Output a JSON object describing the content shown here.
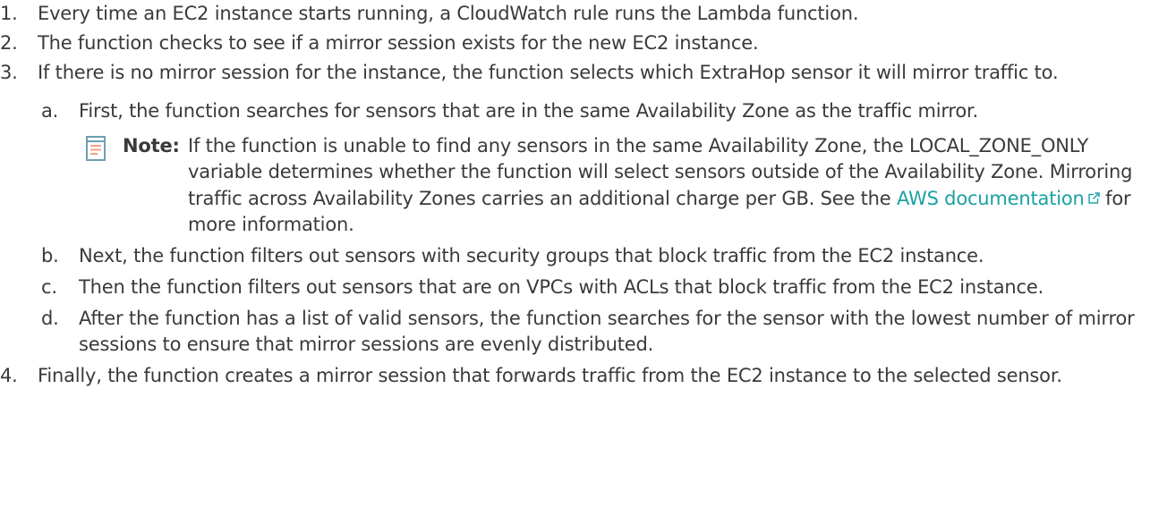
{
  "colors": {
    "text": "#3a3a3a",
    "link": "#1aa1a3",
    "note_icon": "#6f9fb1",
    "note_lines": "#f0a187"
  },
  "steps": [
    {
      "num": "1.",
      "text": "Every time an EC2 instance starts running, a CloudWatch rule runs the Lambda function."
    },
    {
      "num": "2.",
      "text": "The function checks to see if a mirror session exists for the new EC2 instance."
    },
    {
      "num": "3.",
      "text": "If there is no mirror session for the instance, the function selects which ExtraHop sensor it will mirror traffic to."
    },
    {
      "num": "4.",
      "text": "Finally, the function creates a mirror session that forwards traffic from the EC2 instance to the selected sensor."
    }
  ],
  "substeps": [
    {
      "letter": "a.",
      "text": "First, the function searches for sensors that are in the same Availability Zone as the traffic mirror."
    },
    {
      "letter": "b.",
      "text": "Next, the function filters out sensors with security groups that block traffic from the EC2 instance."
    },
    {
      "letter": "c.",
      "text": "Then the function filters out sensors that are on VPCs with ACLs that block traffic from the EC2 instance."
    },
    {
      "letter": "d.",
      "text": "After the function has a list of valid sensors, the function searches for the sensor with the lowest number of mirror sessions to ensure that mirror sessions are evenly distributed."
    }
  ],
  "note": {
    "icon": "note-icon",
    "label": "Note:",
    "text_before_link": "If the function is unable to find any sensors in the same Availability Zone, the LOCAL_ZONE_ONLY variable determines whether the function will select sensors outside of the Availability Zone. Mirroring traffic across Availability Zones carries an additional charge per GB. See the",
    "link_text": "AWS documentation",
    "link_icon": "external-link-icon",
    "text_after_link": "for more information."
  }
}
